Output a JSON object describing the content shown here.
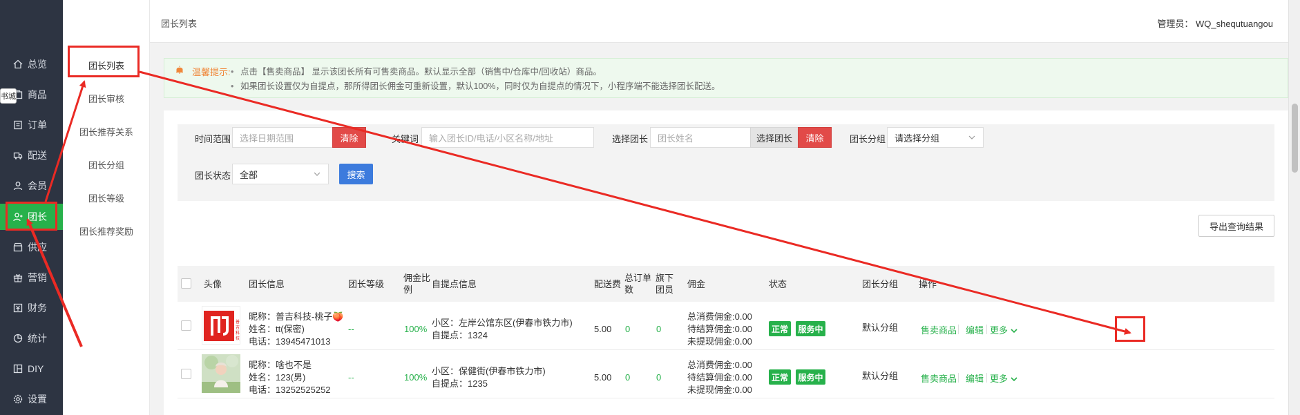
{
  "sidebar": {
    "mall_tag": "书城",
    "items": [
      {
        "label": "总览",
        "icon": "home-icon"
      },
      {
        "label": "商品",
        "icon": "goods-icon"
      },
      {
        "label": "订单",
        "icon": "order-icon"
      },
      {
        "label": "配送",
        "icon": "delivery-icon"
      },
      {
        "label": "会员",
        "icon": "member-icon"
      },
      {
        "label": "团长",
        "icon": "leader-icon"
      },
      {
        "label": "供应",
        "icon": "supply-icon"
      },
      {
        "label": "营销",
        "icon": "gift-icon"
      },
      {
        "label": "财务",
        "icon": "finance-icon"
      },
      {
        "label": "统计",
        "icon": "chart-icon"
      },
      {
        "label": "DIY",
        "icon": "diy-icon"
      },
      {
        "label": "设置",
        "icon": "gear-icon"
      }
    ]
  },
  "submenu": {
    "items": [
      "团长列表",
      "团长审核",
      "团长推荐关系",
      "团长分组",
      "团长等级",
      "团长推荐奖励"
    ]
  },
  "header": {
    "breadcrumb": "团长列表",
    "admin": "管理员： WQ_shequtuangou"
  },
  "tip": {
    "label": "温馨提示:",
    "lines": [
      "点击【售卖商品】 显示该团长所有可售卖商品。默认显示全部（销售中/仓库中/回收站）商品。",
      "如果团长设置仅为自提点，那所得团长佣金可重新设置，默认100%，同时仅为自提点的情况下，小程序端不能选择团长配送。"
    ]
  },
  "filter": {
    "time_label": "时间范围",
    "time_placeholder": "选择日期范围",
    "clear_label": "清除",
    "keyword_label": "关键词",
    "keyword_placeholder": "输入团长ID/电话/小区名称/地址",
    "leader_label": "选择团长",
    "leader_placeholder": "团长姓名",
    "leader_button": "选择团长",
    "group_label": "团长分组",
    "group_value": "请选择分组",
    "status_label": "团长状态",
    "status_value": "全部",
    "search_label": "搜索"
  },
  "export_label": "导出查询结果",
  "table": {
    "headers": {
      "avatar": "头像",
      "info": "团长信息",
      "level": "团长等级",
      "ratio": "佣金比例",
      "pickup": "自提点信息",
      "fee": "配送费",
      "orders": "总订单数",
      "members": "旗下团员",
      "commission": "佣金",
      "status": "状态",
      "group": "团长分组",
      "ops": "操作"
    },
    "rows": [
      {
        "nickname": "昵称：普吉科技-桃子🍑",
        "name": "姓名：tt(保密)",
        "phone": "电话：13945471013",
        "level": "--",
        "ratio": "100%",
        "community": "小区：左岸公馆东区(伊春市铁力市)",
        "pickup": "自提点：1324",
        "fee": "5.00",
        "orders": "0",
        "members": "0",
        "c1": "总消费佣金:0.00",
        "c2": "待结算佣金:0.00",
        "c3": "未提现佣金:0.00",
        "status": "正常",
        "service": "服务中",
        "group": "默认分组",
        "op_goods": "售卖商品",
        "op_edit": "编辑",
        "op_more": "更多"
      },
      {
        "nickname": "昵称：啥也不是",
        "name": "姓名：123(男)",
        "phone": "电话：13252525252",
        "level": "--",
        "ratio": "100%",
        "community": "小区：保健街(伊春市铁力市)",
        "pickup": "自提点：1235",
        "fee": "5.00",
        "orders": "0",
        "members": "0",
        "c1": "总消费佣金:0.00",
        "c2": "待结算佣金:0.00",
        "c3": "未提现佣金:0.00",
        "status": "正常",
        "service": "服务中",
        "group": "默认分组",
        "op_goods": "售卖商品",
        "op_edit": "编辑",
        "op_more": "更多"
      }
    ]
  },
  "colors": {
    "sidebar_bg": "#2d3442",
    "accent_green": "#27b14b",
    "danger_red": "#e24a48",
    "primary_blue": "#3c7bdd",
    "annotation_red": "#ea2a24"
  }
}
